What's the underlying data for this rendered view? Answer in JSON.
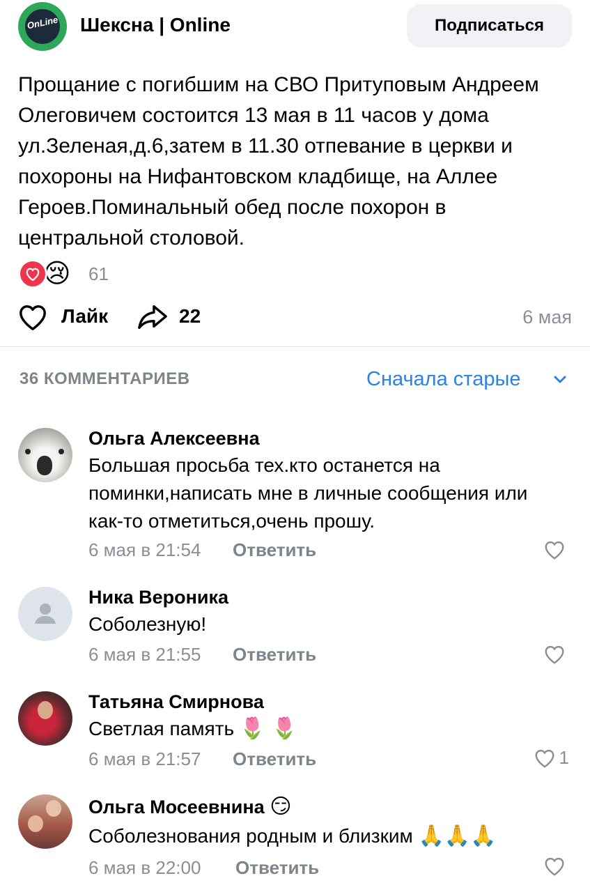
{
  "post": {
    "channel_name": "Шексна | Online",
    "logo_text": "OnLine",
    "subscribe_label": "Подписаться",
    "text": "Прощание с погибшим на СВО Притуповым Андреем Олеговичем состоится 13 мая в 11 часов у дома ул.Зеленая,д.6,затем в 11.30 отпевание в церкви и похороны на Нифантовском кладбище, на Аллее Героев.Поминальный обед после похорон в центральной столовой.",
    "reaction_emoji": "😢",
    "reactions_count": "61",
    "like_label": "Лайк",
    "shares_count": "22",
    "date": "6 мая"
  },
  "comments_header": {
    "count_label": "36 КОММЕНТАРИЕВ",
    "sort_label": "Сначала старые"
  },
  "comments": [
    {
      "name": "Ольга Алексеевна",
      "text": "Большая просьба тех.кто останется на поминки,написать мне в личные сообщения или как-то отметиться,очень прошу.",
      "time": "6 мая в 21:54",
      "reply": "Ответить",
      "likes": ""
    },
    {
      "name": "Ника Вероника",
      "text": "Соболезную!",
      "time": "6 мая в 21:55",
      "reply": "Ответить",
      "likes": ""
    },
    {
      "name": "Татьяна Смирнова",
      "text": "Светлая память",
      "emoji": "🌷 🌷",
      "time": "6 мая в 21:57",
      "reply": "Ответить",
      "likes": "1"
    },
    {
      "name": "Ольга Мосеевнина",
      "name_emoji": "😏",
      "text": "Соболезнования родным и близким",
      "emoji": "🙏🙏🙏",
      "time": "6 мая в 22:00",
      "reply": "Ответить",
      "likes": ""
    }
  ],
  "colors": {
    "accent": "#2d81e0",
    "heart": "#f0344b",
    "secondary_text": "#8a8f97",
    "logo_green": "#2fa75a"
  }
}
